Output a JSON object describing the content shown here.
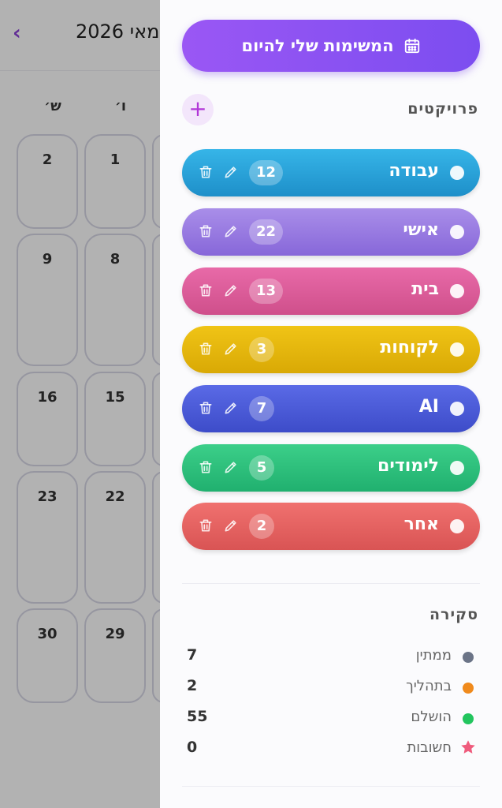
{
  "calendar": {
    "month_label": "מאי 2026",
    "back_icon": "chevron-left-icon",
    "weekdays": [
      "ש׳",
      "ו׳"
    ],
    "days": [
      [
        "2",
        "1"
      ],
      [
        "9",
        "8"
      ],
      [
        "16",
        "15"
      ],
      [
        "23",
        "22"
      ],
      [
        "30",
        "29"
      ]
    ]
  },
  "drawer": {
    "today_button": {
      "label": "המשימות שלי להיום",
      "icon": "calendar-icon"
    },
    "projects_title": "פרויקטים",
    "add_project_icon": "plus-icon",
    "projects": [
      {
        "name": "עבודה",
        "count": "12",
        "color_from": "#36b5e8",
        "color_to": "#1e8fc9"
      },
      {
        "name": "אישי",
        "count": "22",
        "color_from": "#a98ee9",
        "color_to": "#8767d9"
      },
      {
        "name": "בית",
        "count": "13",
        "color_from": "#e86aa8",
        "color_to": "#cf4f8b"
      },
      {
        "name": "לקוחות",
        "count": "3",
        "color_from": "#f0c416",
        "color_to": "#d9a905"
      },
      {
        "name": "AI",
        "count": "7",
        "color_from": "#5a6ae6",
        "color_to": "#3d4cc9"
      },
      {
        "name": "לימודים",
        "count": "5",
        "color_from": "#3ccf89",
        "color_to": "#20b06f"
      },
      {
        "name": "אחר",
        "count": "2",
        "color_from": "#f0716f",
        "color_to": "#d95454"
      }
    ],
    "overview_title": "סקירה",
    "stats": [
      {
        "label": "ממתין",
        "value": "7",
        "color": "#6b7487",
        "icon": "dot"
      },
      {
        "label": "בתהליך",
        "value": "2",
        "color": "#f08a1c",
        "icon": "dot"
      },
      {
        "label": "הושלם",
        "value": "55",
        "color": "#22c55e",
        "icon": "dot"
      },
      {
        "label": "חשובות",
        "value": "0",
        "color": "#ef5b7c",
        "icon": "star-icon"
      }
    ]
  }
}
